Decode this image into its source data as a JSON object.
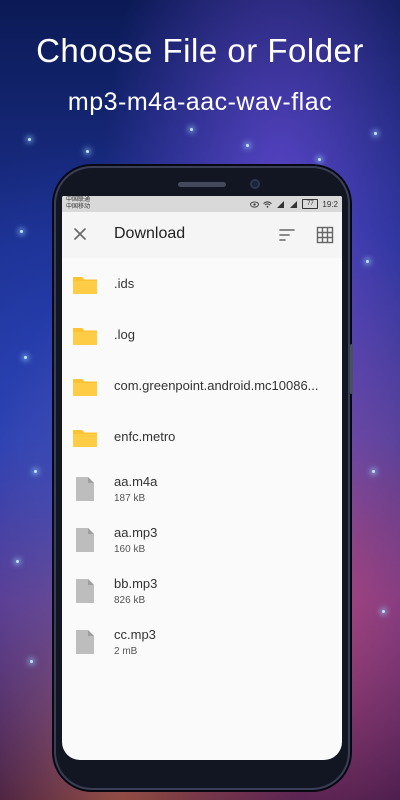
{
  "promo": {
    "title": "Choose File or Folder",
    "subtitle": "mp3-m4a-aac-wav-flac"
  },
  "statusbar": {
    "carrier_line1": "中国联通",
    "carrier_line2": "中国移动",
    "battery": "77",
    "time": "19:2"
  },
  "appbar": {
    "title": "Download"
  },
  "folders": [
    {
      "name": ".ids"
    },
    {
      "name": ".log"
    },
    {
      "name": "com.greenpoint.android.mc10086..."
    },
    {
      "name": "enfc.metro"
    }
  ],
  "files": [
    {
      "name": "aa.m4a",
      "size": "187 kB"
    },
    {
      "name": "aa.mp3",
      "size": "160 kB"
    },
    {
      "name": "bb.mp3",
      "size": "826 kB"
    },
    {
      "name": "cc.mp3",
      "size": "2 mB"
    }
  ],
  "colors": {
    "folder_icon": "#FDC334",
    "file_icon": "#BDBDBD",
    "appbar_bg": "#F5F5F5"
  },
  "icons": {
    "close": "close-icon",
    "sort": "sort-icon",
    "grid": "grid-view-icon",
    "folder": "folder-icon",
    "file": "file-icon"
  }
}
